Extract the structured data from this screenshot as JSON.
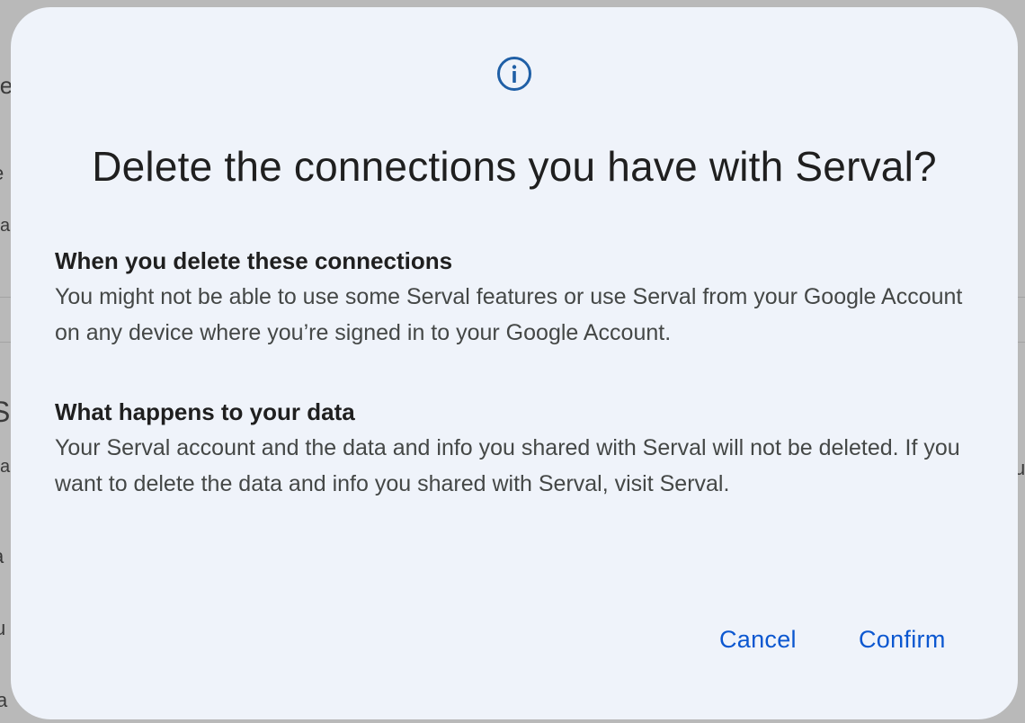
{
  "background": {
    "fragments": [
      "le",
      "e",
      "va",
      "S",
      "va",
      "a",
      "u",
      "a",
      "u"
    ]
  },
  "dialog": {
    "icon": "info-icon",
    "title": "Delete the connections you have with Serval?",
    "sections": [
      {
        "heading": "When you delete these connections",
        "body": "You might not be able to use some Serval features or use Serval from your Google Account on any device where you’re signed in to your Google Account."
      },
      {
        "heading": "What happens to your data",
        "body": "Your Serval account and the data and info you shared with Serval will not be deleted. If you want to delete the data and info you shared with Serval, visit Serval."
      }
    ],
    "buttons": {
      "cancel": "Cancel",
      "confirm": "Confirm"
    }
  },
  "colors": {
    "dialog_bg": "#eff3fa",
    "accent": "#0b57d0",
    "icon": "#1f5fa6",
    "title_text": "#1f1f1f",
    "body_text": "#444746"
  }
}
